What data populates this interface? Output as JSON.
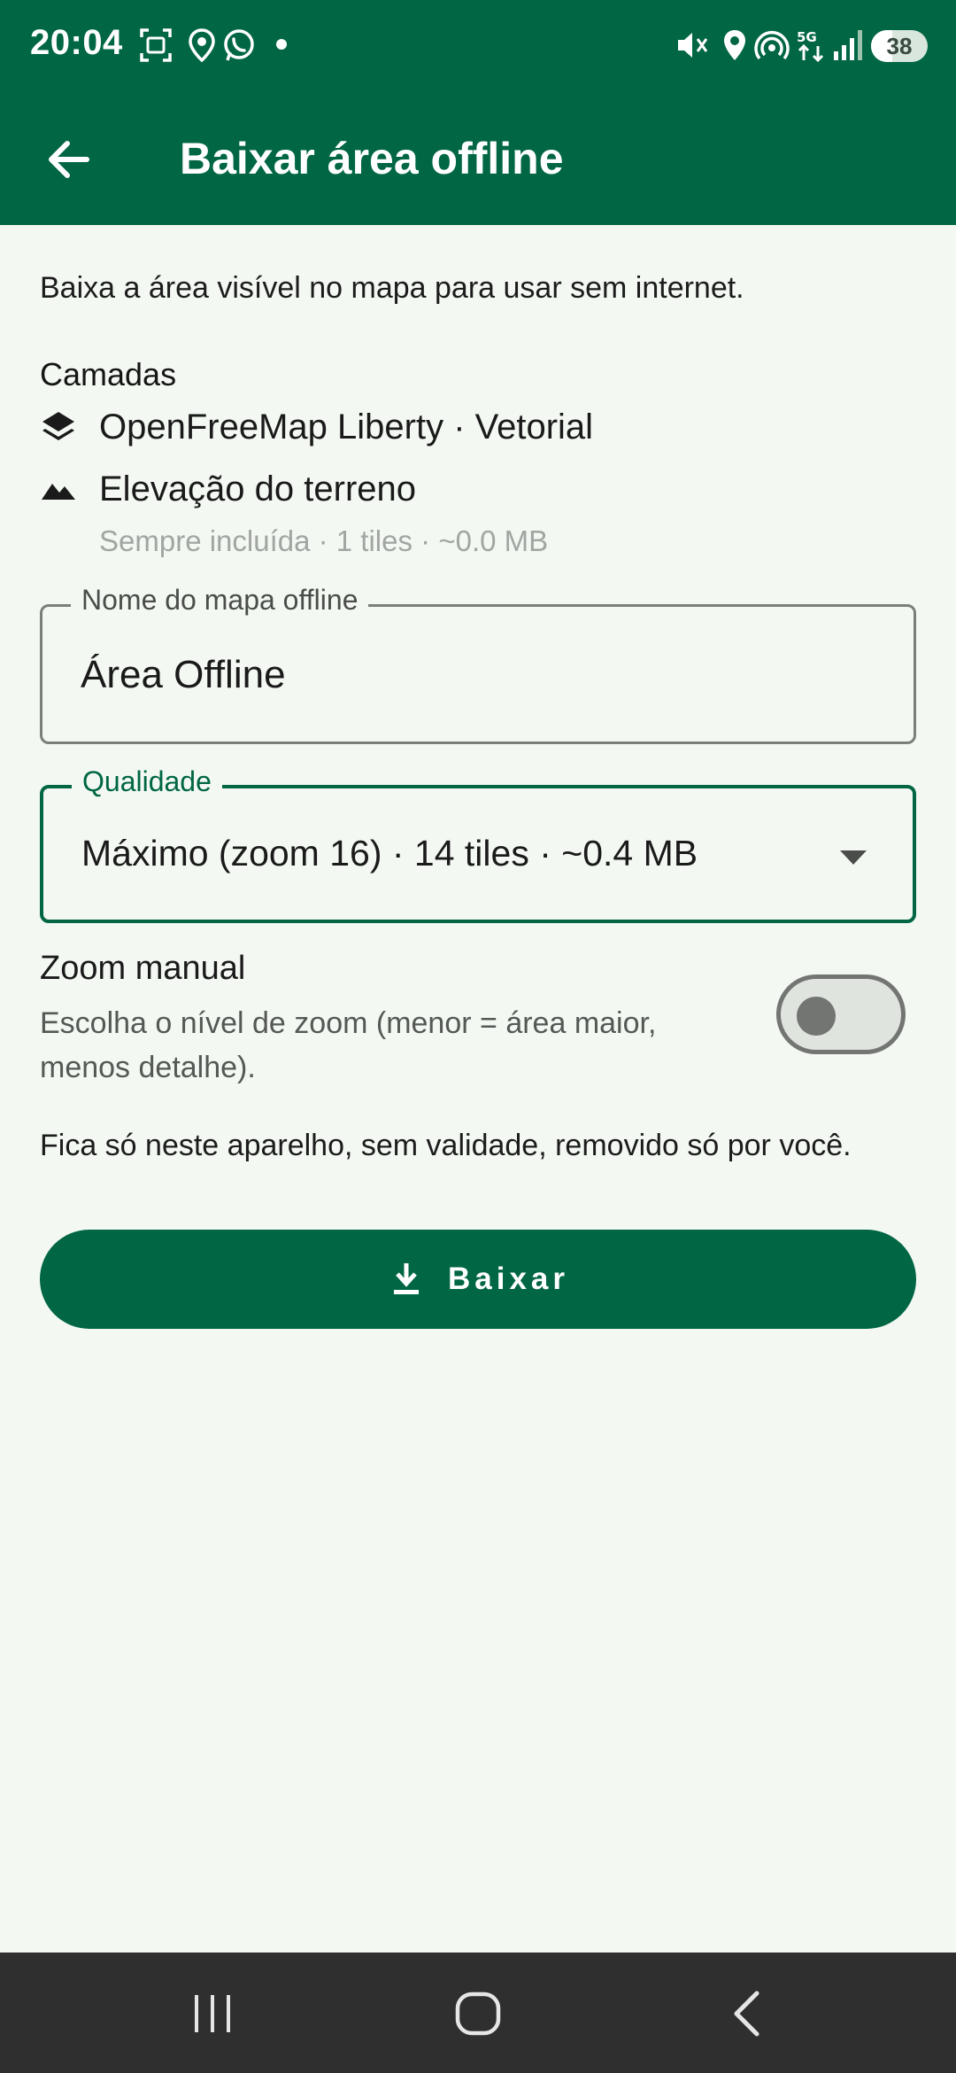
{
  "status_bar": {
    "time": "20:04",
    "battery_level": "38",
    "battery_fraction": 0.38,
    "icons": [
      "screenshot-icon",
      "location-pin-icon",
      "whatsapp-icon",
      "notification-dot-icon",
      "mute-icon",
      "location-icon",
      "hotspot-icon",
      "5g-data-icon",
      "signal-icon",
      "battery-icon"
    ]
  },
  "app_bar": {
    "title": "Baixar área offline",
    "back_icon": "arrow-left-icon"
  },
  "intro_text": "Baixa a área visível no mapa para usar sem internet.",
  "layers": {
    "title": "Camadas",
    "items": [
      {
        "icon": "layers-icon",
        "label": "OpenFreeMap Liberty · Vetorial"
      },
      {
        "icon": "terrain-icon",
        "label": "Elevação do terreno",
        "subtitle": "Sempre incluída · 1 tiles · ~0.0 MB"
      }
    ]
  },
  "name_field": {
    "label": "Nome do mapa offline",
    "value": "Área Offline"
  },
  "quality_field": {
    "label": "Qualidade",
    "value": "Máximo (zoom 16) · 14 tiles · ~0.4 MB",
    "icon": "dropdown-arrow-icon"
  },
  "manual_zoom": {
    "title": "Zoom manual",
    "description": "Escolha o nível de zoom (menor = área maior, menos detalhe).",
    "enabled": false
  },
  "storage_note": "Fica só neste aparelho, sem validade, removido só por você.",
  "download_button": {
    "label": "Baixar",
    "icon": "download-icon"
  },
  "nav_bar": {
    "buttons": [
      "recent-apps-icon",
      "home-icon",
      "back-icon"
    ]
  },
  "colors": {
    "primary": "#006644",
    "background": "#f3f9f2",
    "navbar": "#2f2f2f"
  }
}
